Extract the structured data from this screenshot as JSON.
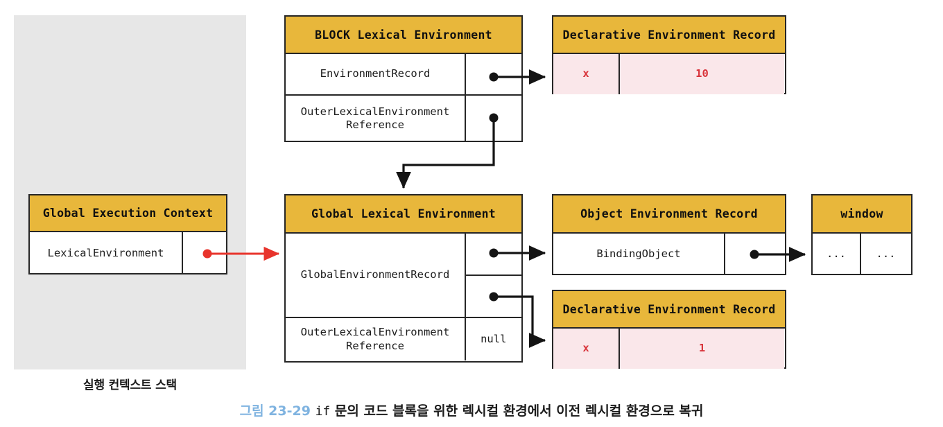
{
  "figure": {
    "stack_label": "실행 컨텍스트 스택",
    "caption_number": "그림 23-29",
    "caption_mono": "if",
    "caption_text": "문의 코드 블록을 위한 렉시컬 환경에서 이전 렉시컬 환경으로 복귀"
  },
  "colors": {
    "header_yellow": "#e8b73b",
    "record_pink": "#fae7ea",
    "record_red_text": "#d8333a",
    "stack_gray": "#e7e7e7",
    "stroke_black": "#262626",
    "arrow_red": "#e8342c",
    "caption_blue": "#7fb3e0"
  },
  "boxes": {
    "block_lexical_environment": {
      "title": "BLOCK Lexical Environment",
      "rows": [
        {
          "label": "EnvironmentRecord",
          "value": ""
        },
        {
          "label": "OuterLexicalEnvironment\nReference",
          "value": ""
        }
      ]
    },
    "block_declarative_record": {
      "title": "Declarative Environment Record",
      "rows": [
        {
          "label": "x",
          "value": "10"
        }
      ]
    },
    "global_execution_context": {
      "title": "Global Execution Context",
      "rows": [
        {
          "label": "LexicalEnvironment",
          "value": ""
        }
      ]
    },
    "global_lexical_environment": {
      "title": "Global Lexical Environment",
      "rows": [
        {
          "label": "GlobalEnvironmentRecord",
          "value": ""
        },
        {
          "label": "OuterLexicalEnvironment\nReference",
          "value": "null"
        }
      ]
    },
    "object_environment_record": {
      "title": "Object Environment Record",
      "rows": [
        {
          "label": "BindingObject",
          "value": ""
        }
      ]
    },
    "window_object": {
      "title": "window",
      "rows": [
        {
          "label": "...",
          "value": "..."
        }
      ]
    },
    "global_declarative_record": {
      "title": "Declarative Environment Record",
      "rows": [
        {
          "label": "x",
          "value": "1"
        }
      ]
    }
  }
}
